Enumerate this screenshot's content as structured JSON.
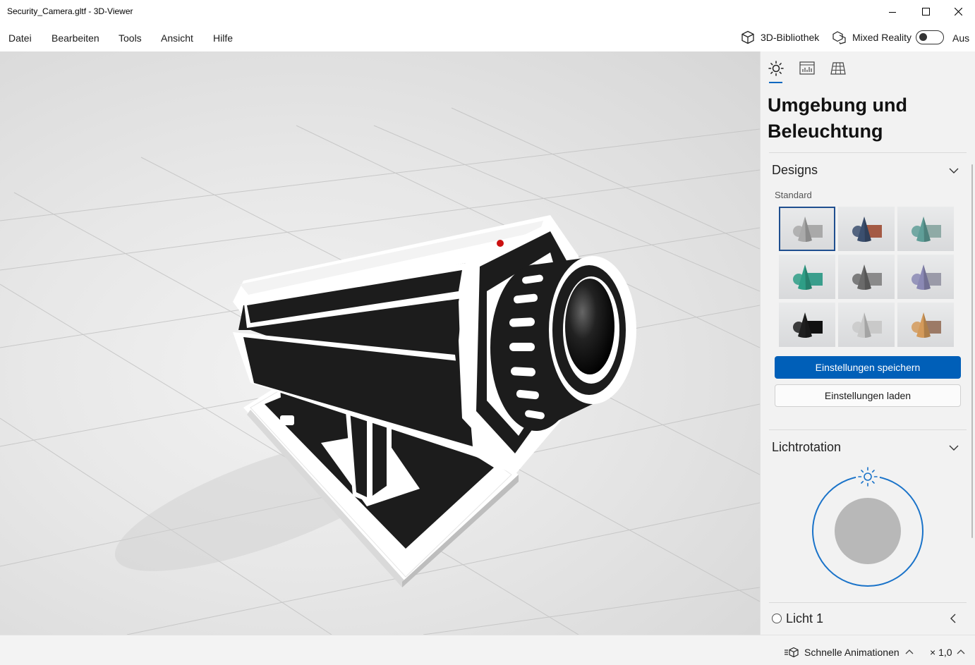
{
  "window": {
    "title": "Security_Camera.gltf - 3D-Viewer",
    "icons": [
      "minimize-icon",
      "maximize-icon",
      "close-icon"
    ]
  },
  "menu": {
    "items": [
      "Datei",
      "Bearbeiten",
      "Tools",
      "Ansicht",
      "Hilfe"
    ],
    "library_label": "3D-Bibliothek",
    "mixed_reality_label": "Mixed Reality",
    "mixed_reality_state": "Aus"
  },
  "panel": {
    "tabs": [
      "sun-icon",
      "stats-icon",
      "grid-icon"
    ],
    "title": "Umgebung und Beleuchtung",
    "designs": {
      "heading": "Designs",
      "subheading": "Standard",
      "selected_index": 0,
      "themes": [
        {
          "shape": "#a9a9a9",
          "box": "#a9a9a9"
        },
        {
          "shape": "#3b4f6e",
          "box": "#a45a44"
        },
        {
          "shape": "#5f9e98",
          "box": "#8faaa6"
        },
        {
          "shape": "#2e9e86",
          "box": "#3a9e8c"
        },
        {
          "shape": "#6a6a6a",
          "box": "#8a8a8a"
        },
        {
          "shape": "#8a88b4",
          "box": "#9a9aa8"
        },
        {
          "shape": "#1f1f1f",
          "box": "#111111"
        },
        {
          "shape": "#c9c9c9",
          "box": "#c9c9c9"
        },
        {
          "shape": "#d49a5a",
          "box": "#9c7a66"
        }
      ],
      "save_label": "Einstellungen speichern",
      "load_label": "Einstellungen laden"
    },
    "light_rotation": {
      "heading": "Lichtrotation",
      "accent": "#1a73c9"
    },
    "light1_label": "Licht 1"
  },
  "status": {
    "animations_label": "Schnelle Animationen",
    "speed_label": "× 1,0"
  },
  "colors": {
    "accent": "#005fb8",
    "panel_bg": "#f2f2f2"
  }
}
